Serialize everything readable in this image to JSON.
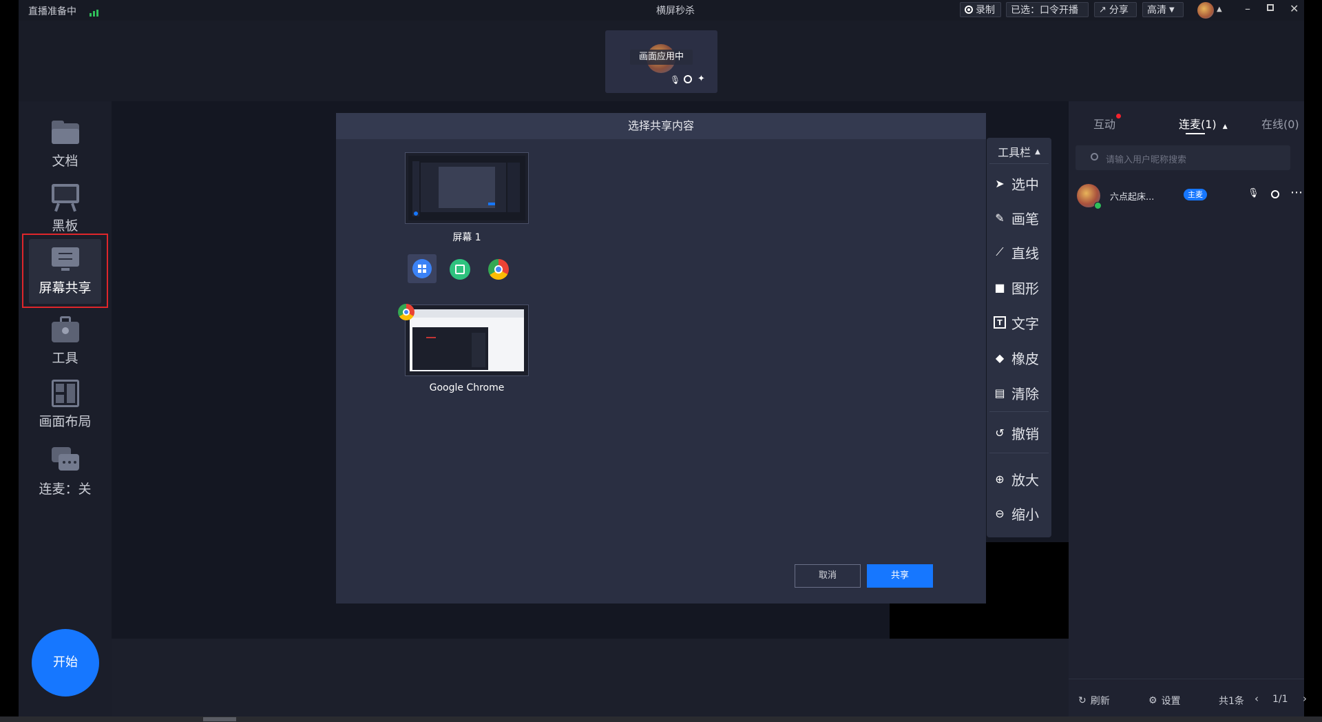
{
  "titlebar": {
    "status": "直播准备中",
    "title": "横屏秒杀",
    "record": "录制",
    "selected": "已选：口令开播",
    "share": "分享",
    "quality": "高清"
  },
  "preview": {
    "label": "画面应用中"
  },
  "sidebar": {
    "items": [
      {
        "label": "文档",
        "icon": "folder-icon"
      },
      {
        "label": "黑板",
        "icon": "blackboard-icon"
      },
      {
        "label": "屏幕共享",
        "icon": "screen-share-icon"
      },
      {
        "label": "工具",
        "icon": "toolbox-icon"
      },
      {
        "label": "画面布局",
        "icon": "layout-icon"
      },
      {
        "label": "连麦：关",
        "icon": "chat-icon"
      }
    ],
    "start_button": "开始"
  },
  "dialog": {
    "title": "选择共享内容",
    "screen_label": "屏幕 1",
    "app_label": "Google Chrome",
    "app_icons": [
      "windows-app-icon",
      "graph-app-icon",
      "chrome-icon"
    ],
    "cancel": "取消",
    "share": "共享"
  },
  "toolbar": {
    "header": "工具栏",
    "tools": [
      {
        "label": "选中",
        "icon": "cursor-icon"
      },
      {
        "label": "画笔",
        "icon": "pen-icon"
      },
      {
        "label": "直线",
        "icon": "line-icon"
      },
      {
        "label": "图形",
        "icon": "shape-icon"
      },
      {
        "label": "文字",
        "icon": "text-icon"
      },
      {
        "label": "橡皮",
        "icon": "eraser-icon"
      },
      {
        "label": "清除",
        "icon": "clear-icon"
      },
      {
        "label": "撤销",
        "icon": "undo-icon"
      },
      {
        "label": "放大",
        "icon": "zoom-in-icon"
      },
      {
        "label": "缩小",
        "icon": "zoom-out-icon"
      }
    ]
  },
  "rightpanel": {
    "tabs": [
      "互动",
      "连麦(1)",
      "在线(0)"
    ],
    "search_placeholder": "请输入用户昵称搜索",
    "user": {
      "name": "六点起床...",
      "badge": "主麦"
    },
    "footer": {
      "refresh": "刷新",
      "settings": "设置",
      "total": "共1条",
      "page": "1/1"
    }
  },
  "colors": {
    "accent": "#1677ff",
    "highlight_border": "#e0262b",
    "dot_red": "#f5222d"
  }
}
